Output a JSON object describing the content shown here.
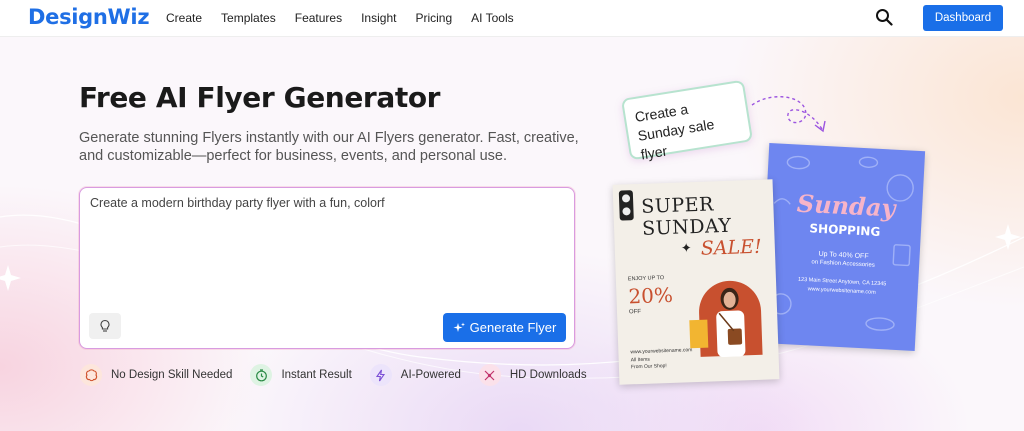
{
  "brand": {
    "logo": "DesignWiz",
    "accent": "#1a6fe8"
  },
  "nav": {
    "items": [
      "Create",
      "Templates",
      "Features",
      "Insight",
      "Pricing",
      "AI Tools"
    ],
    "dashboard_label": "Dashboard",
    "search_icon": "search-icon"
  },
  "hero": {
    "title": "Free AI Flyer Generator",
    "subtitle": "Generate stunning Flyers instantly with our AI Flyers generator. Fast, creative, and customizable—perfect for business, events, and personal use.",
    "prompt_value": "Create a modern birthday party flyer with a fun, colorf",
    "generate_label": "Generate Flyer",
    "features": [
      {
        "label": "No Design Skill Needed",
        "icon": "brain-icon"
      },
      {
        "label": "Instant Result",
        "icon": "timer-icon"
      },
      {
        "label": "AI-Powered",
        "icon": "lightning-icon"
      },
      {
        "label": "HD Downloads",
        "icon": "download-icon"
      }
    ]
  },
  "showcase": {
    "bubble_text": "Create a Sunday sale flyer",
    "flyer_sale": {
      "line1": "SUPER",
      "line2": "SUNDAY",
      "line3": "SALE!",
      "enjoy": "ENJOY UP TO",
      "percent": "20%",
      "off": "OFF",
      "site": "www.yourwebsitename.com",
      "small1": "All Items",
      "small2": "From Our Shop!"
    },
    "flyer_shopping": {
      "line1": "Sunday",
      "line2": "SHOPPING",
      "offer1": "Up To 40% OFF",
      "offer2": "on Fashion Accessories",
      "address": "123 Main Street Anytown, CA 12345",
      "site": "www.yourwebsitename.com"
    }
  }
}
